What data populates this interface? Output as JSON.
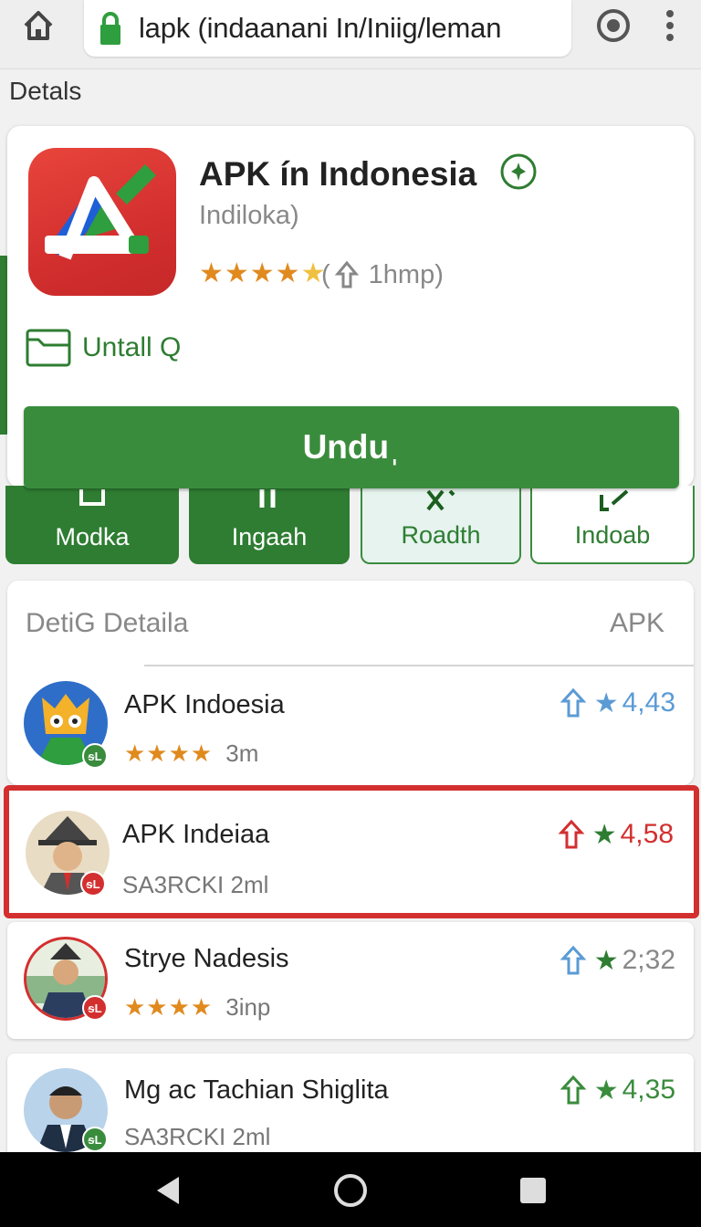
{
  "browser": {
    "url": "lapk (indaanani In/Iniig/leman",
    "icons": [
      "home-icon",
      "lock-icon",
      "settings-icon",
      "more-vert-icon"
    ]
  },
  "section_heading": "Detals",
  "app": {
    "title": "APK ín Indonesia",
    "subtitle": "Indiloka)",
    "stars": "★★★★",
    "meta": "1hmp)",
    "install_label": "Untall Q",
    "download_label": "Unduˌ",
    "colors": {
      "primary_green": "#3a8c3d",
      "icon_red": "#d32f2f"
    }
  },
  "tabs": [
    {
      "label": "Modka",
      "style": "dark"
    },
    {
      "label": "Ingaah",
      "style": "dark"
    },
    {
      "label": "Roadth",
      "style": "light"
    },
    {
      "label": "Indoab",
      "style": "white"
    }
  ],
  "list": {
    "heading": "DetiG Detaila",
    "heading_right": "APK",
    "items": [
      {
        "name": "APK Indoesia",
        "stars": "★★★★",
        "sub": "3m",
        "badge": "ᵴL",
        "rating": "4,43",
        "rating_color": "#5b9bd5"
      },
      {
        "name": "APK  Indeiaa",
        "stars": "",
        "sub": "SA3RCKI 2ml",
        "badge": "ᵴL",
        "rating": "4,58",
        "rating_color": "#d32f2f",
        "selected": true
      },
      {
        "name": "Strye Nadesis",
        "stars": "★★★★",
        "sub": "3inp",
        "badge": "ᵴL",
        "rating": "2;32",
        "rating_color": "#5b9bd5"
      },
      {
        "name": "Mg ac Tachian Shiglita",
        "stars": "",
        "sub": "SA3RCKI 2ml",
        "badge": "ᵴL",
        "rating": "4,35",
        "rating_color": "#3a8c3d"
      }
    ]
  }
}
